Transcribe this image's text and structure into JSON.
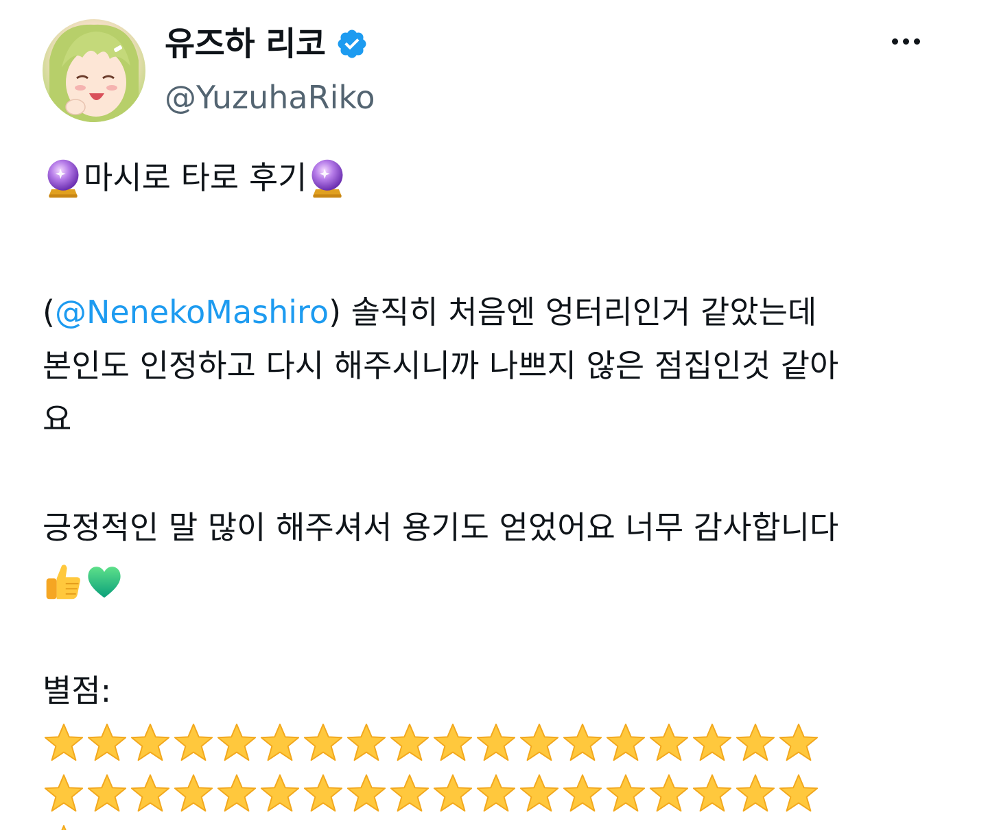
{
  "author": {
    "display_name": "유즈하 리코",
    "handle": "@YuzuhaRiko",
    "verified": true,
    "avatar_icon": "anime-girl-avatar",
    "verified_icon": "verified-badge-icon"
  },
  "menu": {
    "icon": "more-options-icon"
  },
  "tweet": {
    "title_text": "마시로 타로 후기",
    "title_emoji": "crystal-ball",
    "paren_open": "(",
    "mention": "@NenekoMashiro",
    "line1_rest": " ) 솔직히 처음엔 엉터리인거 같았는데",
    "line2": "본인도 인정하고 다시 해주시니까 나쁘지 않은 점집인것 같아",
    "line3": "요",
    "line4": "긍정적인 말 많이 해주셔서 용기도 얻었어요 너무 감사합니다",
    "line5_emojis": [
      "thumbs-up",
      "green-heart"
    ],
    "rating_label": "별점:",
    "rating_stars": 37,
    "star_emoji": "star"
  },
  "colors": {
    "text": "#0f1419",
    "secondary": "#536471",
    "link": "#1d9bf0",
    "verified": "#1d9bf0"
  }
}
